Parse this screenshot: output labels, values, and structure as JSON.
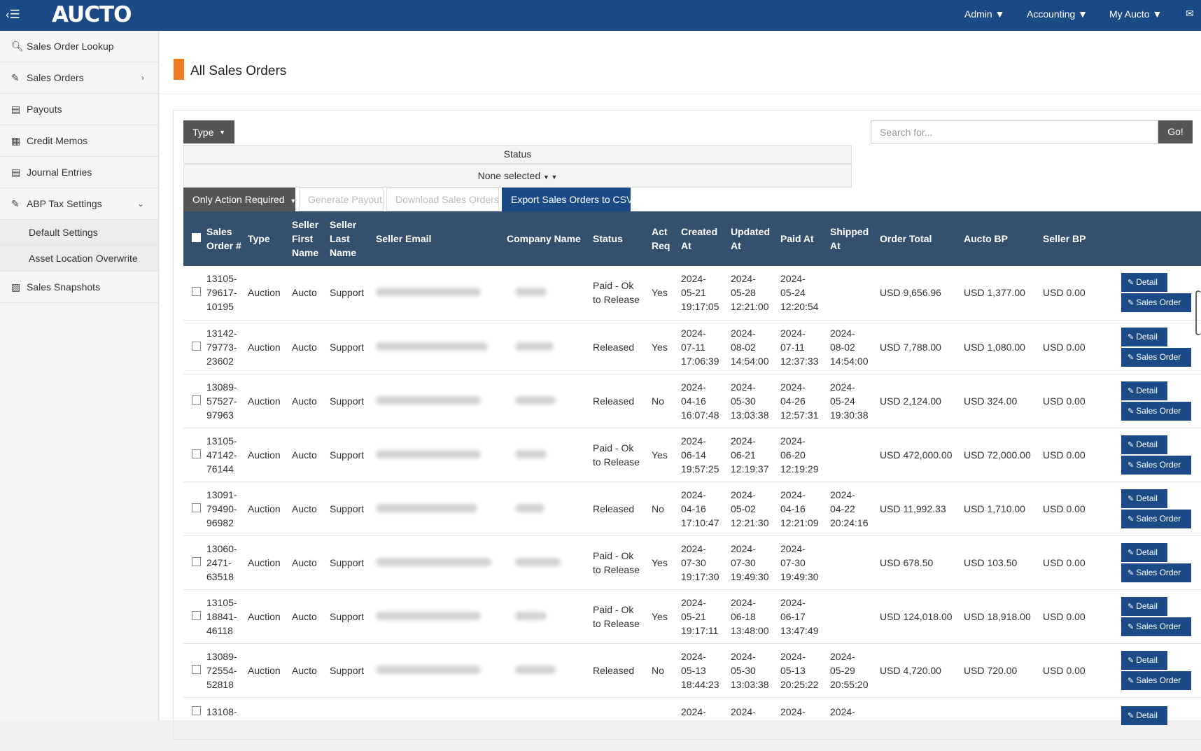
{
  "topbar": {
    "logo_text": "AUCTO",
    "nav": [
      "Admin ▼",
      "Accounting ▼",
      "My Aucto ▼"
    ],
    "mail_icon": "envelope-icon",
    "brand_color": "#1b4a86",
    "accent_color": "#f07a1f"
  },
  "sidebar": {
    "items": [
      {
        "label": "Sales Order Lookup",
        "icon": "search-icon"
      },
      {
        "label": "Sales Orders",
        "icon": "pencil-icon",
        "chevron": "›"
      },
      {
        "label": "Payouts",
        "icon": "book-icon"
      },
      {
        "label": "Credit Memos",
        "icon": "list-alt-icon"
      },
      {
        "label": "Journal Entries",
        "icon": "book-icon"
      },
      {
        "label": "ABP Tax Settings",
        "icon": "pencil-icon",
        "chevron": "⌄"
      }
    ],
    "subitems": [
      "Default Settings",
      "Asset Location Overwrite"
    ],
    "last_item": {
      "label": "Sales Snapshots",
      "icon": "picture-icon"
    }
  },
  "page": {
    "title": "All Sales Orders"
  },
  "filters": {
    "type_label": "Type",
    "status_label": "Status",
    "status_value": "None selected",
    "search_placeholder": "Search for...",
    "go_label": "Go!",
    "action_required_label": "Only Action Required",
    "generate_payout_label": "Generate Payout",
    "download_label": "Download Sales Orders",
    "export_label": "Export Sales Orders to CSV"
  },
  "table": {
    "headers": [
      "Sales Order #",
      "Type",
      "Seller First Name",
      "Seller Last Name",
      "Seller Email",
      "Company Name",
      "Status",
      "Act Req",
      "Created At",
      "Updated At",
      "Paid At",
      "Shipped At",
      "Order Total",
      "Aucto BP",
      "Seller BP"
    ],
    "detail_label": "Detail",
    "sales_order_label": "Sales Order",
    "rows": [
      {
        "so": [
          "13105-",
          "79617-",
          "10195"
        ],
        "type": "Auction",
        "first": "Aucto",
        "last": "Support",
        "status": [
          "Paid - Ok",
          "to Release"
        ],
        "act": "Yes",
        "created": [
          "2024-",
          "05-21",
          "19:17:05"
        ],
        "updated": [
          "2024-",
          "05-28",
          "12:21:00"
        ],
        "paid": [
          "2024-",
          "05-24",
          "12:20:54"
        ],
        "shipped": [
          "",
          "",
          ""
        ],
        "total": "USD 9,656.96",
        "aucto_bp": "USD 1,377.00",
        "seller_bp": "USD 0.00",
        "email_w": 150,
        "company_w": 45
      },
      {
        "so": [
          "13142-",
          "79773-",
          "23602"
        ],
        "type": "Auction",
        "first": "Aucto",
        "last": "Support",
        "status": [
          "Released",
          ""
        ],
        "act": "Yes",
        "created": [
          "2024-",
          "07-11",
          "17:06:39"
        ],
        "updated": [
          "2024-",
          "08-02",
          "14:54:00"
        ],
        "paid": [
          "2024-",
          "07-11",
          "12:37:33"
        ],
        "shipped": [
          "2024-",
          "08-02",
          "14:54:00"
        ],
        "total": "USD 7,788.00",
        "aucto_bp": "USD 1,080.00",
        "seller_bp": "USD 0.00",
        "email_w": 160,
        "company_w": 55
      },
      {
        "so": [
          "13089-",
          "57527-",
          "97963"
        ],
        "type": "Auction",
        "first": "Aucto",
        "last": "Support",
        "status": [
          "Released",
          ""
        ],
        "act": "No",
        "created": [
          "2024-",
          "04-16",
          "16:07:48"
        ],
        "updated": [
          "2024-",
          "05-30",
          "13:03:38"
        ],
        "paid": [
          "2024-",
          "04-26",
          "12:57:31"
        ],
        "shipped": [
          "2024-",
          "05-24",
          "19:30:38"
        ],
        "total": "USD 2,124.00",
        "aucto_bp": "USD 324.00",
        "seller_bp": "USD 0.00",
        "email_w": 150,
        "company_w": 58
      },
      {
        "so": [
          "13105-",
          "47142-",
          "76144"
        ],
        "type": "Auction",
        "first": "Aucto",
        "last": "Support",
        "status": [
          "Paid - Ok",
          "to Release"
        ],
        "act": "Yes",
        "created": [
          "2024-",
          "06-14",
          "19:57:25"
        ],
        "updated": [
          "2024-",
          "06-21",
          "12:19:37"
        ],
        "paid": [
          "2024-",
          "06-20",
          "12:19:29"
        ],
        "shipped": [
          "",
          "",
          ""
        ],
        "total": "USD 472,000.00",
        "aucto_bp": "USD 72,000.00",
        "seller_bp": "USD 0.00",
        "email_w": 150,
        "company_w": 45
      },
      {
        "so": [
          "13091-",
          "79490-",
          "96982"
        ],
        "type": "Auction",
        "first": "Aucto",
        "last": "Support",
        "status": [
          "Released",
          ""
        ],
        "act": "No",
        "created": [
          "2024-",
          "04-16",
          "17:10:47"
        ],
        "updated": [
          "2024-",
          "05-02",
          "12:21:30"
        ],
        "paid": [
          "2024-",
          "04-16",
          "12:21:09"
        ],
        "shipped": [
          "2024-",
          "04-22",
          "20:24:16"
        ],
        "total": "USD 11,992.33",
        "aucto_bp": "USD 1,710.00",
        "seller_bp": "USD 0.00",
        "email_w": 145,
        "company_w": 42
      },
      {
        "so": [
          "13060-",
          "2471-",
          "63518"
        ],
        "type": "Auction",
        "first": "Aucto",
        "last": "Support",
        "status": [
          "Paid - Ok",
          "to Release"
        ],
        "act": "Yes",
        "created": [
          "2024-",
          "07-30",
          "19:17:30"
        ],
        "updated": [
          "2024-",
          "07-30",
          "19:49:30"
        ],
        "paid": [
          "2024-",
          "07-30",
          "19:49:30"
        ],
        "shipped": [
          "",
          "",
          ""
        ],
        "total": "USD 678.50",
        "aucto_bp": "USD 103.50",
        "seller_bp": "USD 0.00",
        "email_w": 165,
        "company_w": 65
      },
      {
        "so": [
          "13105-",
          "18841-",
          "46118"
        ],
        "type": "Auction",
        "first": "Aucto",
        "last": "Support",
        "status": [
          "Paid - Ok",
          "to Release"
        ],
        "act": "Yes",
        "created": [
          "2024-",
          "05-21",
          "19:17:11"
        ],
        "updated": [
          "2024-",
          "06-18",
          "13:48:00"
        ],
        "paid": [
          "2024-",
          "06-17",
          "13:47:49"
        ],
        "shipped": [
          "",
          "",
          ""
        ],
        "total": "USD 124,018.00",
        "aucto_bp": "USD 18,918.00",
        "seller_bp": "USD 0.00",
        "email_w": 150,
        "company_w": 45
      },
      {
        "so": [
          "13089-",
          "72554-",
          "52818"
        ],
        "type": "Auction",
        "first": "Aucto",
        "last": "Support",
        "status": [
          "Released",
          ""
        ],
        "act": "No",
        "created": [
          "2024-",
          "05-13",
          "18:44:23"
        ],
        "updated": [
          "2024-",
          "05-30",
          "13:03:38"
        ],
        "paid": [
          "2024-",
          "05-13",
          "20:25:22"
        ],
        "shipped": [
          "2024-",
          "05-29",
          "20:55:20"
        ],
        "total": "USD 4,720.00",
        "aucto_bp": "USD 720.00",
        "seller_bp": "USD 0.00",
        "email_w": 150,
        "company_w": 58
      }
    ],
    "partial_row": {
      "so": "13108-",
      "created": "2024-",
      "updated": "2024-",
      "paid": "2024-",
      "shipped": "2024-"
    }
  }
}
